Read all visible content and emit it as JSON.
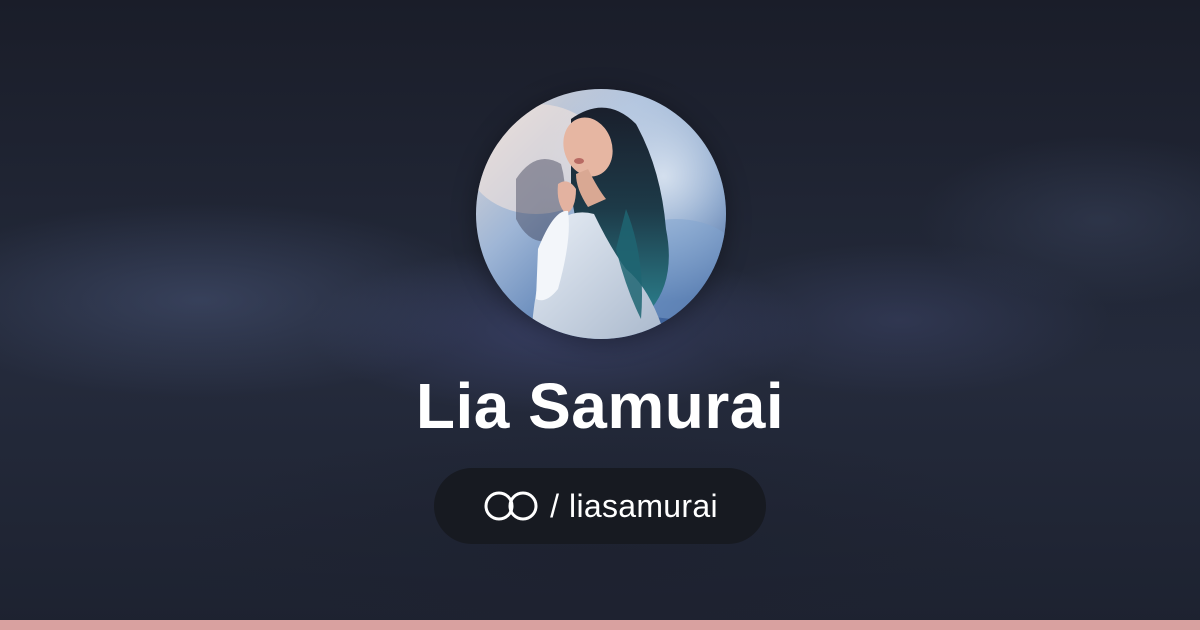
{
  "profile": {
    "name": "Lia Samurai",
    "handle_separator": "/",
    "handle": "liasamurai",
    "avatar_icon": "profile-photo",
    "logo_icon": "linked-circles-icon"
  },
  "colors": {
    "background": "#1b1f2b",
    "pill": "#171a21",
    "text": "#ffffff",
    "bottom_bar": "#d9a1a0"
  }
}
